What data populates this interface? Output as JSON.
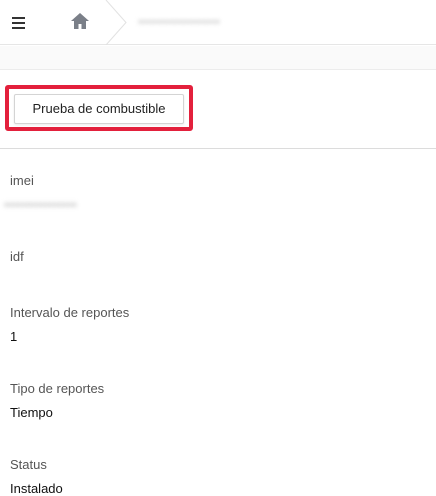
{
  "header": {
    "menu_icon": "hamburger-menu-icon",
    "home_icon": "home-icon",
    "breadcrumb_current": "••••••••••••••••••"
  },
  "actions": {
    "fuel_test_label": "Prueba de combustible",
    "highlight_color": "#e3203c"
  },
  "fields": [
    {
      "label": "imei",
      "value": "••••••••••••••••"
    },
    {
      "label": "idf",
      "value": ""
    },
    {
      "label": "Intervalo de reportes",
      "value": "1"
    },
    {
      "label": "Tipo de reportes",
      "value": "Tiempo"
    },
    {
      "label": "Status",
      "value": "Instalado"
    }
  ]
}
